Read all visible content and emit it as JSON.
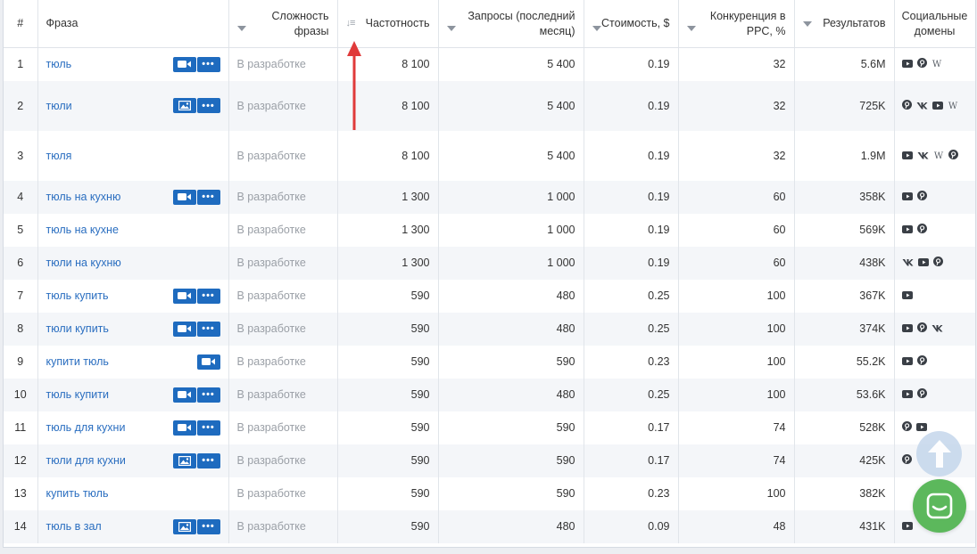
{
  "headers": {
    "num": "#",
    "phrase": "Фраза",
    "difficulty": "Сложность фразы",
    "frequency": "Частотность",
    "requests": "Запросы (последний месяц)",
    "cost": "Стоимость, $",
    "competition": "Конкуренция в PPC, %",
    "results": "Результатов",
    "social": "Социальные домены"
  },
  "colors": {
    "link": "#2a6ec0",
    "badge": "#1e6bbf",
    "annotation_arrow": "#e03a3a",
    "chat": "#5cb85c"
  },
  "rows": [
    {
      "n": "1",
      "kw": "тюль",
      "dev": "В разработке",
      "freq": "8 100",
      "req": "5 400",
      "cost": "0.19",
      "comp": "32",
      "res": "5.6M",
      "badges": [
        "video",
        "more"
      ],
      "social": [
        "youtube-icon",
        "pinterest-icon",
        "wikipedia-icon"
      ]
    },
    {
      "n": "2",
      "kw": "тюли",
      "dev": "В разработке",
      "freq": "8 100",
      "req": "5 400",
      "cost": "0.19",
      "comp": "32",
      "res": "725K",
      "badges": [
        "image",
        "more"
      ],
      "social": [
        "pinterest-icon",
        "vk-icon",
        "youtube-icon",
        "wikipedia-icon"
      ]
    },
    {
      "n": "3",
      "kw": "тюля",
      "dev": "В разработке",
      "freq": "8 100",
      "req": "5 400",
      "cost": "0.19",
      "comp": "32",
      "res": "1.9M",
      "badges": [],
      "social": [
        "youtube-icon",
        "vk-icon",
        "wikipedia-icon",
        "pinterest-icon"
      ]
    },
    {
      "n": "4",
      "kw": "тюль на кухню",
      "dev": "В разработке",
      "freq": "1 300",
      "req": "1 000",
      "cost": "0.19",
      "comp": "60",
      "res": "358K",
      "badges": [
        "video",
        "more"
      ],
      "social": [
        "youtube-icon",
        "pinterest-icon"
      ]
    },
    {
      "n": "5",
      "kw": "тюль на кухне",
      "dev": "В разработке",
      "freq": "1 300",
      "req": "1 000",
      "cost": "0.19",
      "comp": "60",
      "res": "569K",
      "badges": [],
      "social": [
        "youtube-icon",
        "pinterest-icon"
      ]
    },
    {
      "n": "6",
      "kw": "тюли на кухню",
      "dev": "В разработке",
      "freq": "1 300",
      "req": "1 000",
      "cost": "0.19",
      "comp": "60",
      "res": "438K",
      "badges": [],
      "social": [
        "vk-icon",
        "youtube-icon",
        "pinterest-icon"
      ]
    },
    {
      "n": "7",
      "kw": "тюль купить",
      "dev": "В разработке",
      "freq": "590",
      "req": "480",
      "cost": "0.25",
      "comp": "100",
      "res": "367K",
      "badges": [
        "video",
        "more"
      ],
      "social": [
        "youtube-icon"
      ]
    },
    {
      "n": "8",
      "kw": "тюли купить",
      "dev": "В разработке",
      "freq": "590",
      "req": "480",
      "cost": "0.25",
      "comp": "100",
      "res": "374K",
      "badges": [
        "video",
        "more"
      ],
      "social": [
        "youtube-icon",
        "pinterest-icon",
        "vk-icon"
      ]
    },
    {
      "n": "9",
      "kw": "купити тюль",
      "dev": "В разработке",
      "freq": "590",
      "req": "590",
      "cost": "0.23",
      "comp": "100",
      "res": "55.2K",
      "badges": [
        "video"
      ],
      "social": [
        "youtube-icon",
        "pinterest-icon"
      ]
    },
    {
      "n": "10",
      "kw": "тюль купити",
      "dev": "В разработке",
      "freq": "590",
      "req": "480",
      "cost": "0.25",
      "comp": "100",
      "res": "53.6K",
      "badges": [
        "video",
        "more"
      ],
      "social": [
        "youtube-icon",
        "pinterest-icon"
      ]
    },
    {
      "n": "11",
      "kw": "тюль для кухни",
      "dev": "В разработке",
      "freq": "590",
      "req": "590",
      "cost": "0.17",
      "comp": "74",
      "res": "528K",
      "badges": [
        "video",
        "more"
      ],
      "social": [
        "pinterest-icon",
        "youtube-icon"
      ]
    },
    {
      "n": "12",
      "kw": "тюли для кухни",
      "dev": "В разработке",
      "freq": "590",
      "req": "590",
      "cost": "0.17",
      "comp": "74",
      "res": "425K",
      "badges": [
        "image",
        "more"
      ],
      "social": [
        "pinterest-icon"
      ]
    },
    {
      "n": "13",
      "kw": "купить тюль",
      "dev": "В разработке",
      "freq": "590",
      "req": "590",
      "cost": "0.23",
      "comp": "100",
      "res": "382K",
      "badges": [],
      "social": []
    },
    {
      "n": "14",
      "kw": "тюль в зал",
      "dev": "В разработке",
      "freq": "590",
      "req": "480",
      "cost": "0.09",
      "comp": "48",
      "res": "431K",
      "badges": [
        "image",
        "more"
      ],
      "social": [
        "youtube-icon"
      ]
    }
  ]
}
